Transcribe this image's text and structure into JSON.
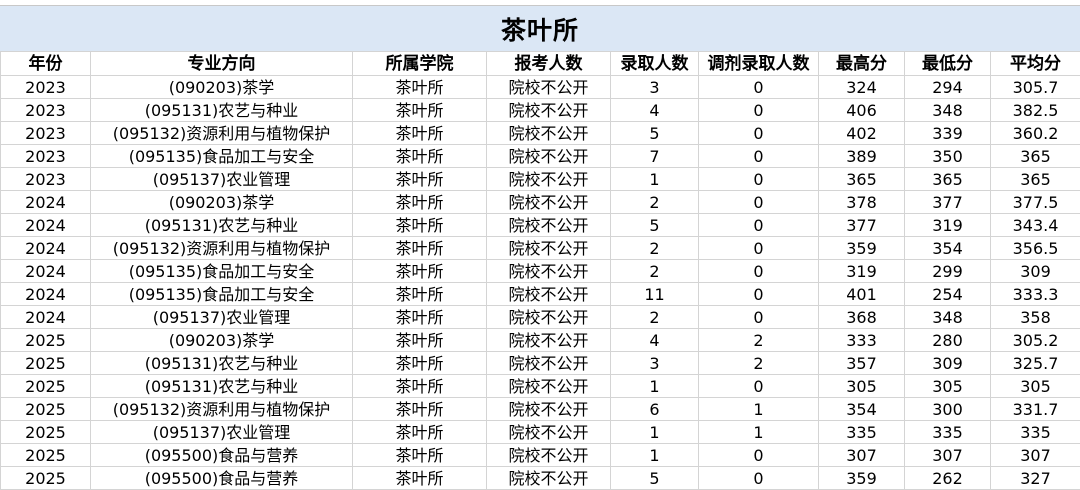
{
  "sheet_title": "茶叶所",
  "headers": [
    "年份",
    "专业方向",
    "所属学院",
    "报考人数",
    "录取人数",
    "调剂录取人数",
    "最高分",
    "最低分",
    "平均分"
  ],
  "rows": [
    [
      "2023",
      "(090203)茶学",
      "茶叶所",
      "院校不公开",
      "3",
      "0",
      "324",
      "294",
      "305.7"
    ],
    [
      "2023",
      "(095131)农艺与种业",
      "茶叶所",
      "院校不公开",
      "4",
      "0",
      "406",
      "348",
      "382.5"
    ],
    [
      "2023",
      "(095132)资源利用与植物保护",
      "茶叶所",
      "院校不公开",
      "5",
      "0",
      "402",
      "339",
      "360.2"
    ],
    [
      "2023",
      "(095135)食品加工与安全",
      "茶叶所",
      "院校不公开",
      "7",
      "0",
      "389",
      "350",
      "365"
    ],
    [
      "2023",
      "(095137)农业管理",
      "茶叶所",
      "院校不公开",
      "1",
      "0",
      "365",
      "365",
      "365"
    ],
    [
      "2024",
      "(090203)茶学",
      "茶叶所",
      "院校不公开",
      "2",
      "0",
      "378",
      "377",
      "377.5"
    ],
    [
      "2024",
      "(095131)农艺与种业",
      "茶叶所",
      "院校不公开",
      "5",
      "0",
      "377",
      "319",
      "343.4"
    ],
    [
      "2024",
      "(095132)资源利用与植物保护",
      "茶叶所",
      "院校不公开",
      "2",
      "0",
      "359",
      "354",
      "356.5"
    ],
    [
      "2024",
      "(095135)食品加工与安全",
      "茶叶所",
      "院校不公开",
      "2",
      "0",
      "319",
      "299",
      "309"
    ],
    [
      "2024",
      "(095135)食品加工与安全",
      "茶叶所",
      "院校不公开",
      "11",
      "0",
      "401",
      "254",
      "333.3"
    ],
    [
      "2024",
      "(095137)农业管理",
      "茶叶所",
      "院校不公开",
      "2",
      "0",
      "368",
      "348",
      "358"
    ],
    [
      "2025",
      "(090203)茶学",
      "茶叶所",
      "院校不公开",
      "4",
      "2",
      "333",
      "280",
      "305.2"
    ],
    [
      "2025",
      "(095131)农艺与种业",
      "茶叶所",
      "院校不公开",
      "3",
      "2",
      "357",
      "309",
      "325.7"
    ],
    [
      "2025",
      "(095131)农艺与种业",
      "茶叶所",
      "院校不公开",
      "1",
      "0",
      "305",
      "305",
      "305"
    ],
    [
      "2025",
      "(095132)资源利用与植物保护",
      "茶叶所",
      "院校不公开",
      "6",
      "1",
      "354",
      "300",
      "331.7"
    ],
    [
      "2025",
      "(095137)农业管理",
      "茶叶所",
      "院校不公开",
      "1",
      "1",
      "335",
      "335",
      "335"
    ],
    [
      "2025",
      "(095500)食品与营养",
      "茶叶所",
      "院校不公开",
      "1",
      "0",
      "307",
      "307",
      "307"
    ],
    [
      "2025",
      "(095500)食品与营养",
      "茶叶所",
      "院校不公开",
      "5",
      "0",
      "359",
      "262",
      "327"
    ]
  ],
  "colors": {
    "title_band": "#dbe7f5",
    "grid": "#d4d4d4"
  }
}
